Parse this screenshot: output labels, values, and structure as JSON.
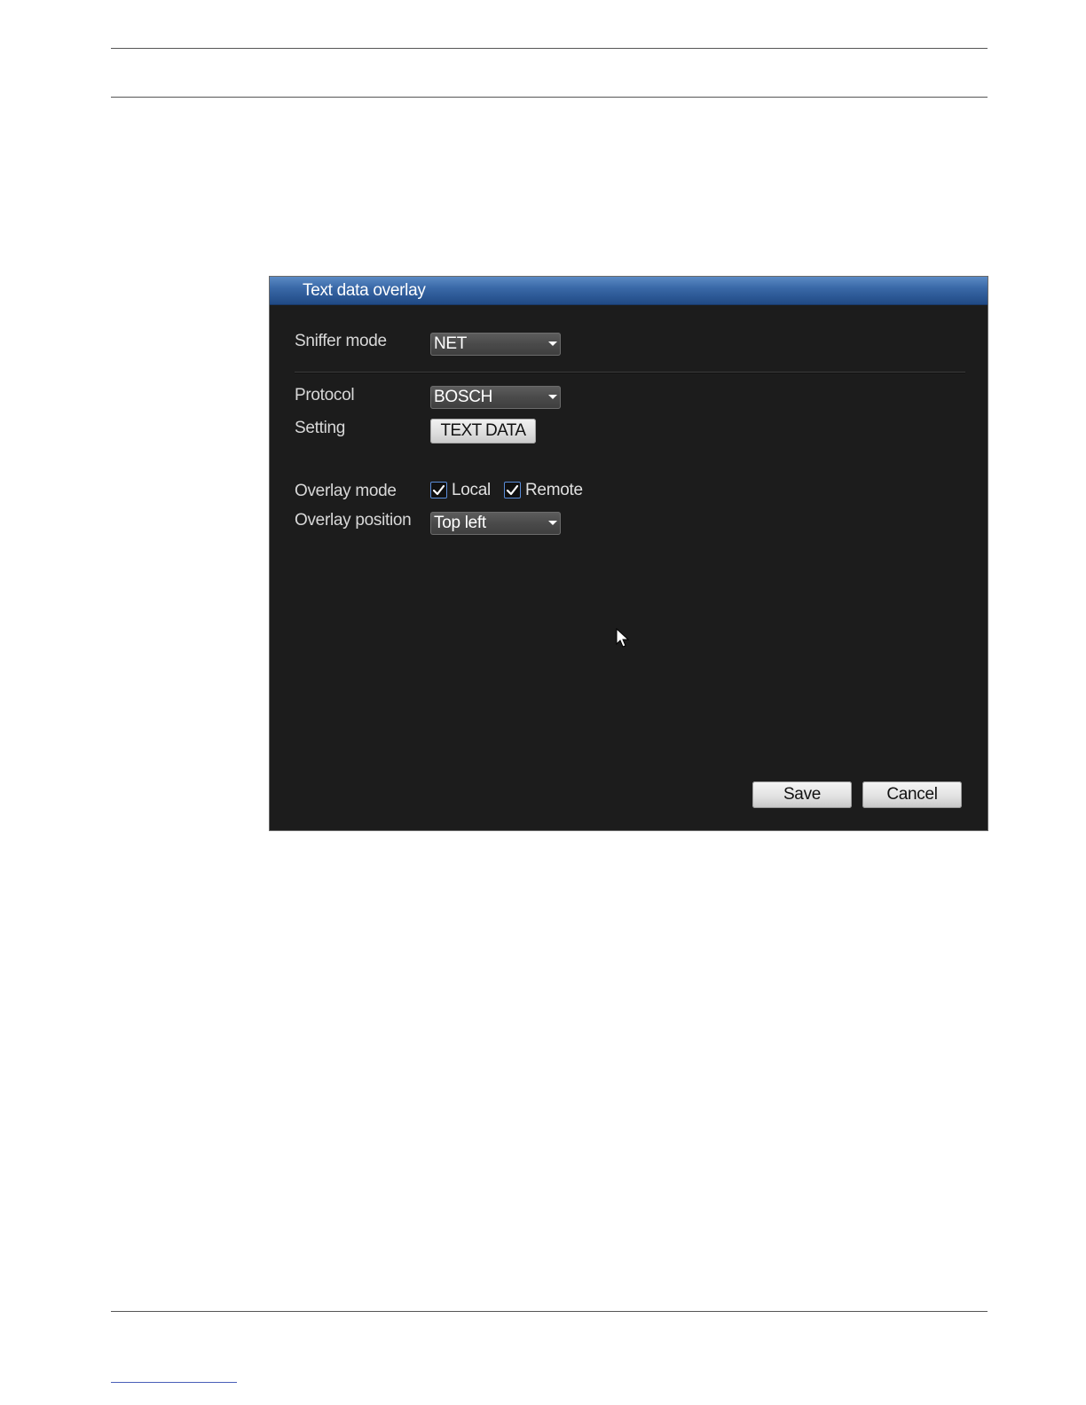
{
  "dialog": {
    "title": "Text data overlay",
    "sniffer_mode": {
      "label": "Sniffer mode",
      "value": "NET"
    },
    "protocol": {
      "label": "Protocol",
      "value": "BOSCH"
    },
    "setting": {
      "label": "Setting",
      "button_label": "TEXT DATA"
    },
    "overlay_mode": {
      "label": "Overlay mode",
      "local_label": "Local",
      "local_checked": true,
      "remote_label": "Remote",
      "remote_checked": true
    },
    "overlay_position": {
      "label": "Overlay position",
      "value": "Top left"
    },
    "save_label": "Save",
    "cancel_label": "Cancel"
  },
  "icons": {
    "dropdown": "chevron-down-icon",
    "check": "check-icon",
    "cursor": "mouse-pointer-icon"
  },
  "colors": {
    "titlebar": "#3a69a8",
    "dialog_bg": "#1c1c1c",
    "checkbox_border": "#5a8cd8"
  }
}
